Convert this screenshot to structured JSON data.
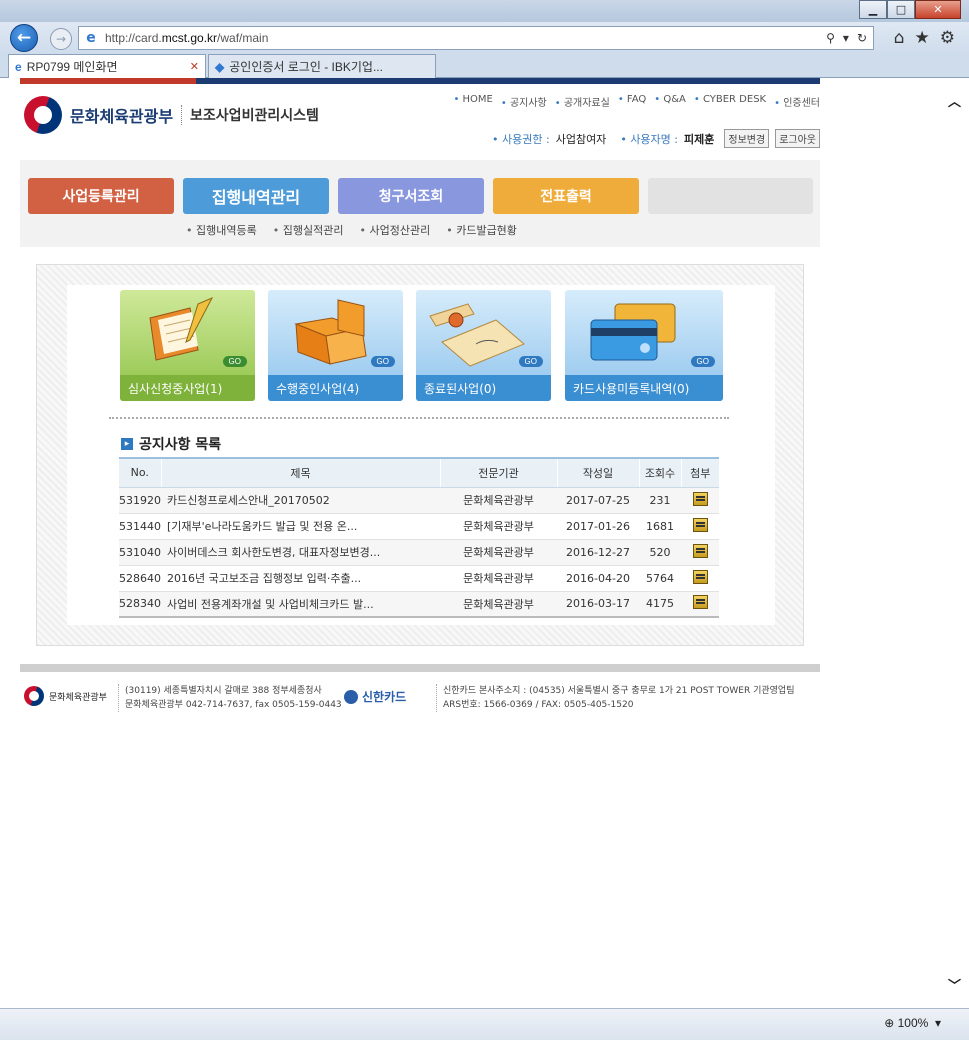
{
  "browser": {
    "url_prefix": "http://card.",
    "url_host": "mcst.go.kr",
    "url_path": "/waf/main",
    "tabs": [
      {
        "title": "RP0799 메인화면"
      },
      {
        "title": "공인인증서 로그인 - IBK기업..."
      }
    ],
    "zoom": "100%"
  },
  "site": {
    "ministry": "문화체육관광부",
    "system": "보조사업비관리시스템",
    "toplinks": [
      "HOME",
      "공지사항",
      "공개자료실",
      "FAQ",
      "Q&A",
      "CYBER DESK",
      "인증센터"
    ],
    "user": {
      "role_label": "사용권한 :",
      "role": "사업참여자",
      "name_label": "사용자명 :",
      "name": "피제훈",
      "edit_btn": "정보변경",
      "logout_btn": "로그아웃"
    },
    "menu": [
      "사업등록관리",
      "집행내역관리",
      "청구서조회",
      "전표출력"
    ],
    "submenu": [
      "집행내역등록",
      "집행실적관리",
      "사업정산관리",
      "카드발급현황"
    ],
    "cards": [
      {
        "title": "심사신청중사업(1)",
        "go": "GO"
      },
      {
        "title": "수행중인사업(4)",
        "go": "GO"
      },
      {
        "title": "종료된사업(0)",
        "go": "GO"
      },
      {
        "title": "카드사용미등록내역(0)",
        "go": "GO"
      }
    ],
    "notice": {
      "title": "공지사항 목록",
      "headers": [
        "No.",
        "제목",
        "전문기관",
        "작성일",
        "조회수",
        "첨부"
      ],
      "rows": [
        {
          "no": "531920",
          "subject": "카드신청프로세스안내_20170502",
          "org": "문화체육관광부",
          "date": "2017-07-25",
          "views": "231"
        },
        {
          "no": "531440",
          "subject": "[기재부'e나라도움카드 발급 및 전용 온...",
          "org": "문화체육관광부",
          "date": "2017-01-26",
          "views": "1681"
        },
        {
          "no": "531040",
          "subject": "사이버데스크 회사한도변경, 대표자정보변경...",
          "org": "문화체육관광부",
          "date": "2016-12-27",
          "views": "520"
        },
        {
          "no": "528640",
          "subject": "2016년 국고보조금 집행정보 입력·추출...",
          "org": "문화체육관광부",
          "date": "2016-04-20",
          "views": "5764"
        },
        {
          "no": "528340",
          "subject": "사업비 전용계좌개설 및 사업비체크카드 발...",
          "org": "문화체육관광부",
          "date": "2016-03-17",
          "views": "4175"
        }
      ]
    },
    "footer": {
      "ministry": "문화체육관광부",
      "addr_line1": "(30119) 세종특별자치시 갈매로 388 정부세종청사",
      "addr_line2": "문화체육관광부 042-714-7637, fax 0505-159-0443",
      "card_brand": "신한카드",
      "card_line1": "신한카드 본사주소지 : (04535) 서울특별시 중구 충무로 1가 21 POST TOWER 기관영업팀",
      "card_line2": "ARS번호: 1566-0369 / FAX: 0505-405-1520"
    }
  }
}
